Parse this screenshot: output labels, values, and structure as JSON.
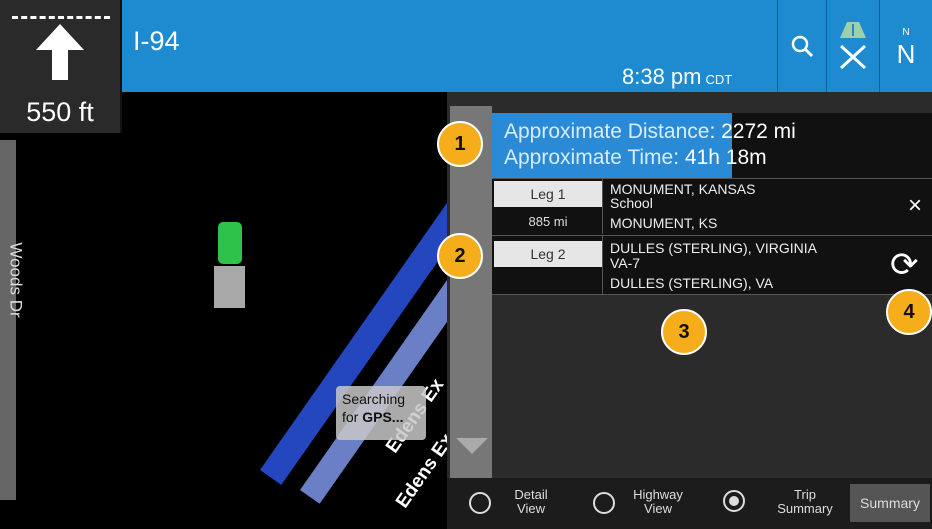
{
  "nav": {
    "distance_to_turn": "550 ft",
    "road_name": "I-94",
    "time": "8:38 pm",
    "timezone": "CDT",
    "compass": "N",
    "compass_small": "N"
  },
  "map": {
    "side_street": "Woods Dr",
    "road_label_1": "Edens Ex",
    "road_label_2": "Edens Ex",
    "gps_status_line1": "Searching",
    "gps_status_line2_prefix": "for ",
    "gps_status_line2_bold": "GPS..."
  },
  "trip": {
    "distance_label": "Approximate Distance",
    "distance_value": ": 2272 mi",
    "time_label": "Approximate Time",
    "time_value": ": 41h 18m",
    "legs": [
      {
        "label": "Leg 1",
        "distance": "885 mi",
        "line1": "MONUMENT, KANSAS",
        "line2": "School",
        "line3": "MONUMENT, KS",
        "action_icon": "close-icon",
        "action_glyph": "×"
      },
      {
        "label": "Leg 2",
        "distance": "",
        "line1": "DULLES (STERLING), VIRGINIA",
        "line2": "VA-7",
        "line3": "DULLES (STERLING), VA",
        "action_icon": "refresh-icon",
        "action_glyph": "⟳"
      }
    ]
  },
  "callouts": [
    "1",
    "2",
    "3",
    "4"
  ],
  "bottom_bar": {
    "options": [
      {
        "line1": "Detail",
        "line2": "View",
        "selected": false
      },
      {
        "line1": "Highway",
        "line2": "View",
        "selected": false
      },
      {
        "line1": "Trip",
        "line2": "Summary",
        "selected": true
      }
    ],
    "summary_button": "Summary"
  },
  "colors": {
    "header": "#1e8ad0",
    "highlight": "#2a8ad6",
    "callout": "#f5ad1c"
  }
}
